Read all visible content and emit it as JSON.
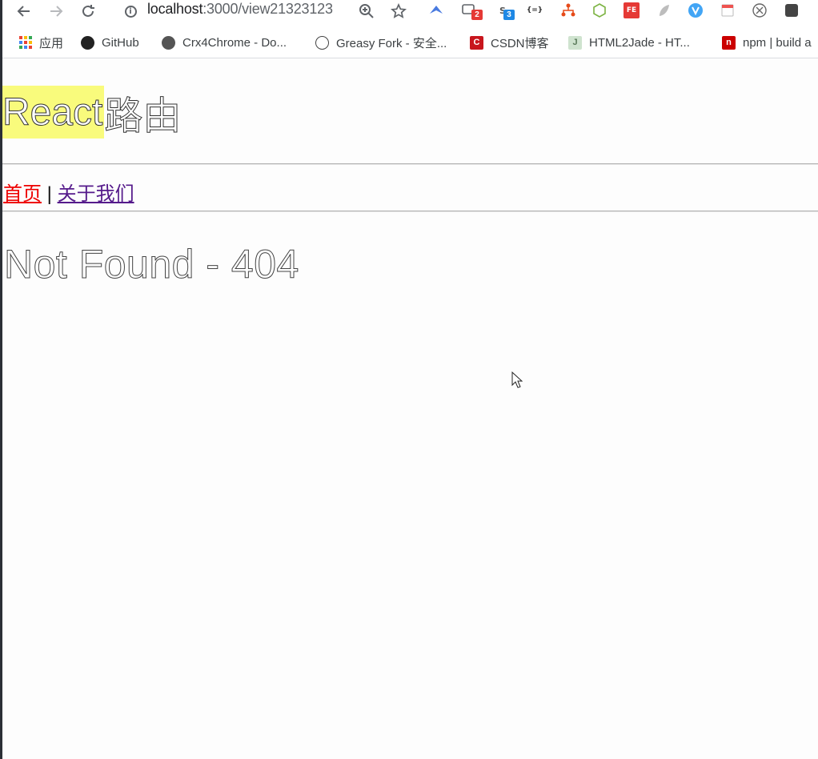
{
  "browser": {
    "url_host": "localhost",
    "url_rest": ":3000/view21323123",
    "bookmarks": [
      {
        "label": "应用",
        "icon": "apps-grid-icon"
      },
      {
        "label": "GitHub",
        "icon": "github-icon"
      },
      {
        "label": "Crx4Chrome - Do...",
        "icon": "crx4chrome-icon"
      },
      {
        "label": "Greasy Fork - 安全...",
        "icon": "greasyfork-icon"
      },
      {
        "label": "CSDN博客",
        "icon": "csdn-icon"
      },
      {
        "label": "HTML2Jade - HT...",
        "icon": "html2jade-icon"
      },
      {
        "label": "npm | build a",
        "icon": "npm-icon"
      }
    ],
    "ext_badges": {
      "badge_a": "2",
      "badge_b": "3"
    },
    "ext_labels": {
      "fe": "FE",
      "s": "S",
      "json": "{=}"
    }
  },
  "page": {
    "title_highlight": "React",
    "title_rest": "路由",
    "nav_home": "首页",
    "nav_sep": "|",
    "nav_about": "关于我们",
    "not_found": "Not Found - 404"
  },
  "colors": {
    "highlight": "#f9fb7c",
    "link_active": "#ee0000",
    "link_visited": "#551a8b"
  }
}
